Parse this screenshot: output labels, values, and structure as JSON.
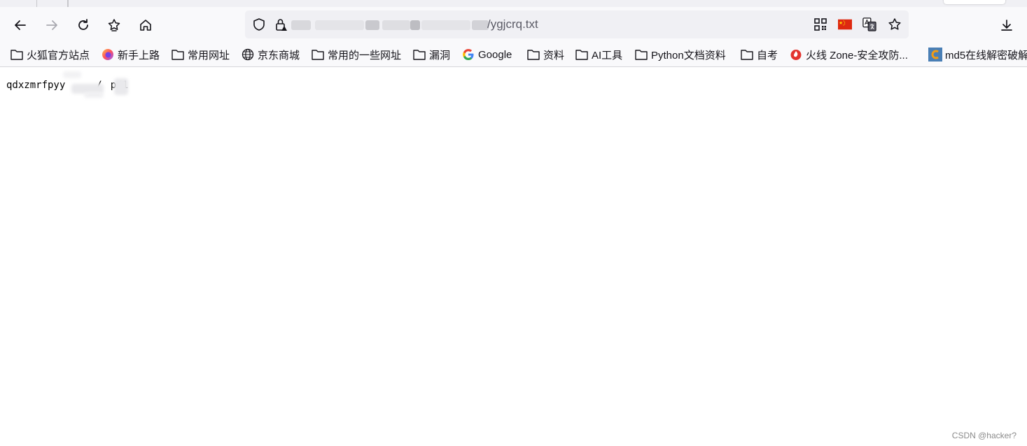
{
  "browser": {
    "address_bar": {
      "url_suffix": "/ygjcrq.txt"
    },
    "toolbar": {
      "back_icon": "arrow-left-icon",
      "forward_icon": "arrow-right-icon",
      "reload_icon": "reload-icon",
      "bookmark_manager_icon": "star-list-icon",
      "home_icon": "home-icon",
      "download_icon": "download-icon"
    },
    "bookmarks": [
      {
        "label": "火狐官方站点",
        "icon": "folder-icon"
      },
      {
        "label": "新手上路",
        "icon": "firefox-icon"
      },
      {
        "label": "常用网址",
        "icon": "folder-icon"
      },
      {
        "label": "京东商城",
        "icon": "globe-icon"
      },
      {
        "label": "常用的一些网址",
        "icon": "folder-icon"
      },
      {
        "label": "漏洞",
        "icon": "folder-icon"
      },
      {
        "label": "Google",
        "icon": "google-icon"
      },
      {
        "label": "资料",
        "icon": "folder-icon"
      },
      {
        "label": "AI工具",
        "icon": "folder-icon"
      },
      {
        "label": "Python文档资料",
        "icon": "folder-icon"
      },
      {
        "label": "自考",
        "icon": "folder-icon"
      },
      {
        "label": "火线 Zone-安全攻防...",
        "icon": "huoxian-icon"
      },
      {
        "label": "md5在线解密破解",
        "icon": "cmd5-icon"
      }
    ]
  },
  "page": {
    "text_prefix": "qdxzmrfpyy",
    "text_mid": "/",
    "text_suffix": "p/1"
  },
  "watermark": "CSDN @hacker?"
}
